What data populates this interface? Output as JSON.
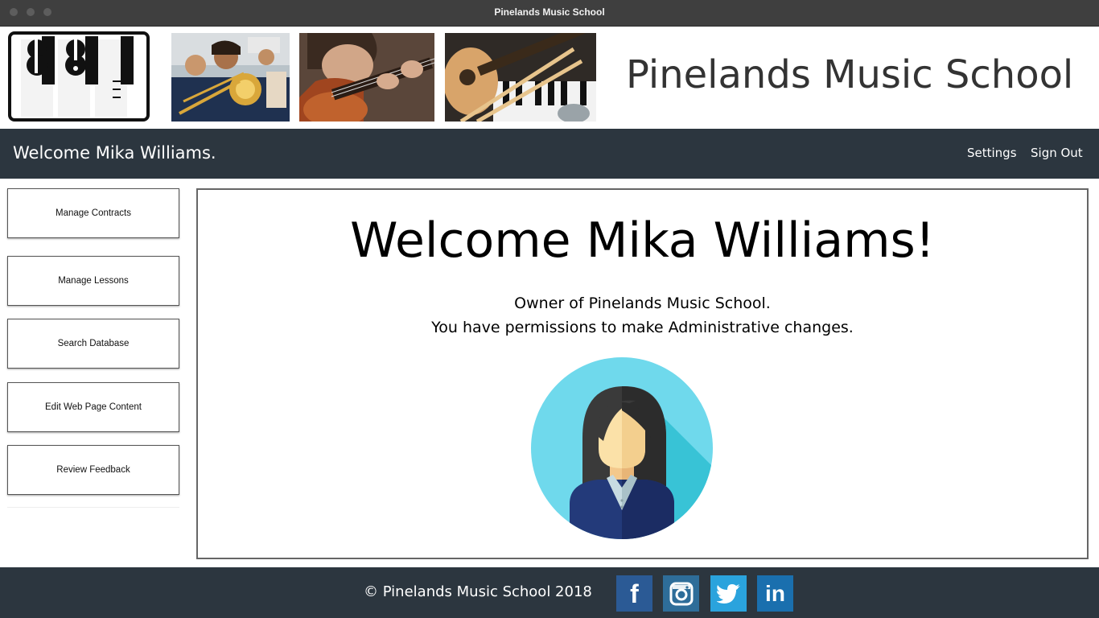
{
  "window": {
    "title": "Pinelands Music School"
  },
  "header": {
    "site_title": "Pinelands Music School"
  },
  "navbar": {
    "welcome": "Welcome Mika Williams.",
    "links": [
      "Settings",
      "Sign Out"
    ]
  },
  "sidebar": {
    "items": [
      {
        "label": "Manage Contracts"
      },
      {
        "label": "Manage Lessons"
      },
      {
        "label": "Search Database"
      },
      {
        "label": "Edit Web Page Content"
      },
      {
        "label": "Review Feedback"
      }
    ]
  },
  "main": {
    "heading": "Welcome Mika Williams!",
    "role": "Owner of Pinelands Music School.",
    "permissions": "You have permissions to make Administrative changes."
  },
  "footer": {
    "copyright": "© Pinelands Music School   2018",
    "social": [
      {
        "name": "facebook-icon",
        "glyph": "f",
        "color": "#2b5a95"
      },
      {
        "name": "instagram-icon",
        "glyph": "",
        "color": "#2e6d99"
      },
      {
        "name": "twitter-icon",
        "glyph": "",
        "color": "#2aa3dd"
      },
      {
        "name": "linkedin-icon",
        "glyph": "in",
        "color": "#1a6fae"
      }
    ]
  },
  "colors": {
    "navbar": "#2c363f",
    "footer": "#2c363f",
    "avatar_bg": "#6fd9ec"
  }
}
